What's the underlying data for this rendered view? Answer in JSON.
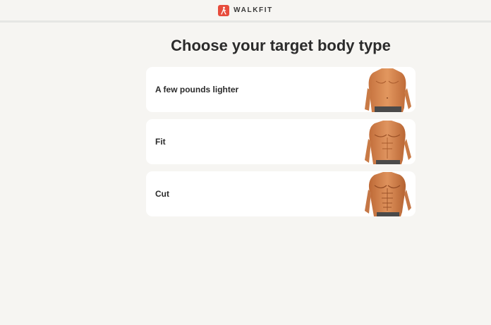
{
  "header": {
    "brand": "WALKFIT",
    "logo_icon": "walking-person-icon",
    "accent_color": "#e74c3c"
  },
  "page": {
    "title": "Choose your target body type"
  },
  "options": [
    {
      "label": "A few pounds lighter",
      "image": "torso-lighter-image"
    },
    {
      "label": "Fit",
      "image": "torso-fit-image"
    },
    {
      "label": "Cut",
      "image": "torso-cut-image"
    }
  ]
}
